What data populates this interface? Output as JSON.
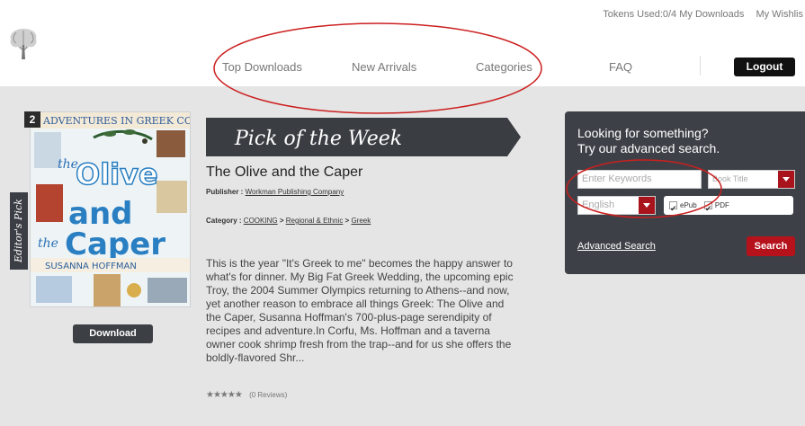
{
  "util": {
    "tokens": "Tokens Used:0/4",
    "downloads": "My Downloads",
    "wishlist": "My Wishlis"
  },
  "nav": {
    "top_downloads": "Top Downloads",
    "new_arrivals": "New Arrivals",
    "categories": "Categories",
    "faq": "FAQ",
    "logout": "Logout"
  },
  "feature": {
    "rank": "2",
    "editors_pick": "Editor's Pick",
    "banner": "Pick of the Week",
    "title": "The Olive and the Caper",
    "publisher_label": "Publisher :",
    "publisher": "Workman Publishing Company",
    "category_label": "Category :",
    "category_1": "COOKING",
    "category_2": "Regional & Ethnic",
    "category_3": "Greek",
    "sep": ">",
    "description": "This is the year \"It's Greek to me\" becomes the happy answer to what's for dinner. My Big Fat Greek Wedding, the upcoming epic Troy, the 2004 Summer Olympics returning to Athens--and now, yet another reason to embrace all things Greek: The Olive and the Caper, Susanna Hoffman's 700-plus-page serendipity of recipes and adventure.In Corfu, Ms. Hoffman and a taverna owner cook shrimp fresh from the trap--and for us she offers the boldly-flavored Shr...",
    "reviews": "(0 Reviews)",
    "download": "Download"
  },
  "cover": {
    "top": "ADVENTURES IN GREEK COOKING",
    "the1": "the",
    "olive": "Olive",
    "and": "and",
    "the2": "the",
    "caper": "Caper",
    "author": "SUSANNA HOFFMAN"
  },
  "search": {
    "heading_1": "Looking for something?",
    "heading_2": "Try our advanced search.",
    "keywords_placeholder": "Enter Keywords",
    "field_select": "Book Title",
    "language_select": "English",
    "epub": "ePub",
    "pdf": "PDF",
    "advanced": "Advanced Search",
    "button": "Search"
  },
  "colors": {
    "accent_red": "#b5121b",
    "dark_panel": "#3d4147",
    "annotation_red": "#cc1f1f"
  }
}
